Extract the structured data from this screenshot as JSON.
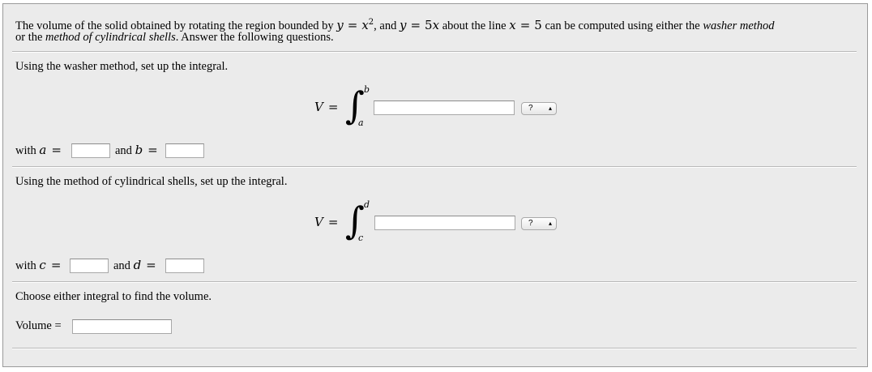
{
  "intro": {
    "p1": "The volume of the solid obtained by rotating the region bounded by ",
    "m1": "y",
    "eq": "=",
    "m2": "x",
    "sup2": "2",
    "p2": ", and ",
    "m3": "y",
    "m4": "5",
    "m5": "x",
    "p3": " about the line ",
    "m6": "x",
    "m7": "5",
    "p4": " can be computed using either the ",
    "washer": "washer method",
    "line2_or": "or the ",
    "shells": "method of cylindrical shells",
    "line2_rest": ". Answer the following questions."
  },
  "washer": {
    "heading": "Using the washer method, set up the integral.",
    "V": "V",
    "eq": "=",
    "upper": "b",
    "lower": "a",
    "select_value": "?",
    "with_label": "with ",
    "a_var": "a",
    "and_label": "and ",
    "b_var": "b"
  },
  "shells": {
    "heading": "Using the method of cylindrical shells, set up the integral.",
    "V": "V",
    "eq": "=",
    "upper": "d",
    "lower": "c",
    "select_value": "?",
    "with_label": "with ",
    "c_var": "c",
    "and_label": "and ",
    "d_var": "d"
  },
  "final": {
    "heading": "Choose either integral to find the volume.",
    "volume_label": "Volume ="
  },
  "icons": {
    "select_arrows": "up-down-arrows-icon"
  }
}
